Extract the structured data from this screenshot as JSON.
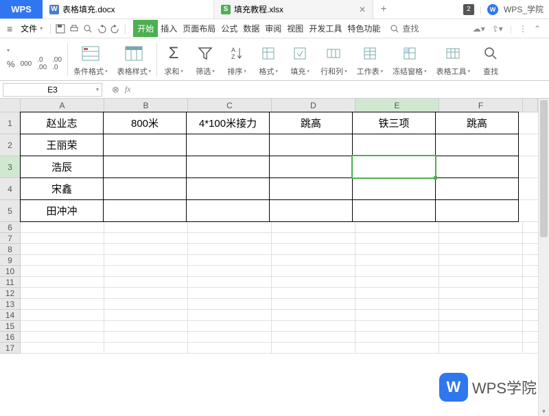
{
  "titlebar": {
    "logo": "WPS",
    "tab_doc": "表格填充.docx",
    "tab_xls": "填充教程.xlsx",
    "tab_count": "2",
    "academy": "WPS_学院"
  },
  "menubar": {
    "file": "文件",
    "tabs": {
      "start": "开始",
      "insert": "插入",
      "page_layout": "页面布局",
      "formula": "公式",
      "data": "数据",
      "review": "审阅",
      "view": "视图",
      "dev_tools": "开发工具",
      "special": "特色功能"
    },
    "search": "查找"
  },
  "ribbon": {
    "percent": "%",
    "thousand": "000",
    "inc_dec": ".0",
    "dec_inc": ".00",
    "cond_format": "条件格式",
    "table_style": "表格样式",
    "sum": "求和",
    "filter": "筛选",
    "sort": "排序",
    "format": "格式",
    "fill": "填充",
    "row_col": "行和列",
    "worksheet": "工作表",
    "freeze": "冻结窗格",
    "table_tools": "表格工具",
    "find": "查找"
  },
  "formula_bar": {
    "name_box": "E3",
    "fx": "fx"
  },
  "columns": [
    "A",
    "B",
    "C",
    "D",
    "E",
    "F"
  ],
  "row_labels": [
    "1",
    "2",
    "3",
    "4",
    "5",
    "6",
    "7",
    "8",
    "9",
    "10",
    "11",
    "12",
    "13",
    "14",
    "15",
    "16",
    "17"
  ],
  "cells": {
    "A1": "赵业志",
    "B1": "800米",
    "C1": "4*100米接力",
    "D1": "跳高",
    "E1": "铁三项",
    "F1": "跳高",
    "A2": "王丽荣",
    "A3": "浩辰",
    "A4": "宋鑫",
    "A5": "田冲冲"
  },
  "active_cell": "E3",
  "watermark": {
    "icon_text": "W",
    "label": "WPS学院"
  }
}
